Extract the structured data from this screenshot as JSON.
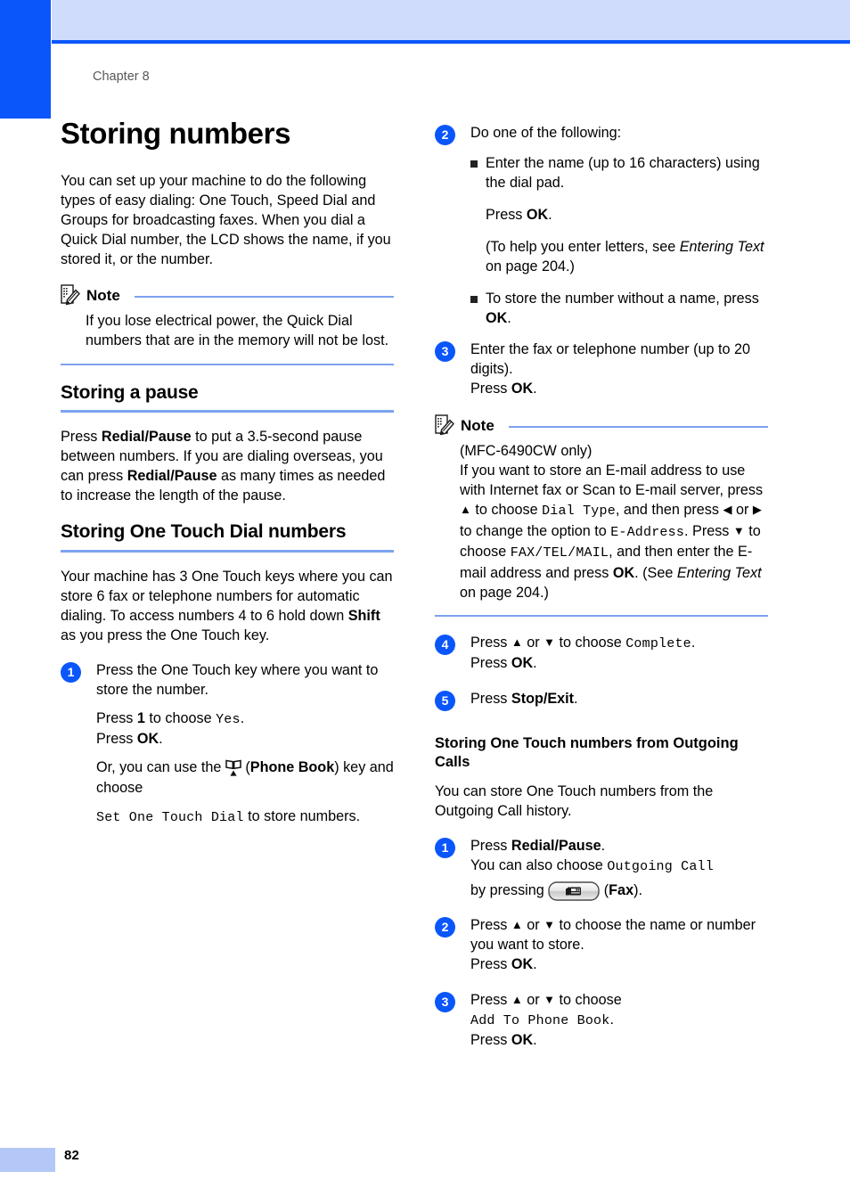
{
  "page": {
    "chapter_label": "Chapter 8",
    "page_number": "82",
    "accent_blue": "#0a56fb",
    "rule_blue": "#7da2ef",
    "band_blue": "#cfdcfb",
    "footer_blue": "#b3c8f7"
  },
  "left_column": {
    "title": "Storing numbers",
    "intro": "You can set up your machine to do the following types of easy dialing: One Touch, Speed Dial and Groups for broadcasting faxes. When you dial a Quick Dial number, the LCD shows the name, if you stored it, or the number.",
    "note": {
      "label": "Note",
      "body": "If you lose electrical power, the Quick Dial numbers that are in the memory will not be lost."
    },
    "pause_section": {
      "heading": "Storing a pause",
      "text_1": "Press ",
      "bold_1": "Redial/Pause",
      "text_2": " to put a 3.5-second pause between numbers. If you are dialing overseas, you can press ",
      "bold_2": "Redial/Pause",
      "text_3": " as many times as needed to increase the length of the pause."
    },
    "onetouch_section": {
      "heading": "Storing One Touch Dial numbers",
      "text_1": "Your machine has 3 One Touch keys where you can store 6 fax or telephone numbers for automatic dialing. To access numbers 4 to 6 hold down ",
      "bold_1": "Shift",
      "text_2": " as you press the One Touch key."
    },
    "step_1": {
      "number": "1",
      "line_1": "Press the One Touch key where you want to store the number.",
      "line_2_a": "Press ",
      "line_2_bold": "1",
      "line_2_b": " to choose ",
      "line_2_lcd": "Yes",
      "line_2_c": ".",
      "line_3_a": "Press ",
      "line_3_bold": "OK",
      "line_3_b": ".",
      "line_4_a": "Or, you can use the ",
      "line_4_icon": "phone-book-icon",
      "line_4_b": " (",
      "line_4_bold": "Phone Book",
      "line_4_c": ") key and choose",
      "line_5_lcd": "Set One Touch Dial",
      "line_5_b": " to store numbers."
    }
  },
  "right_column": {
    "step_2": {
      "number": "2",
      "lead": "Do one of the following:",
      "bullet_1": {
        "line_1": "Enter the name (up to 16 characters) using the dial pad.",
        "line_2_a": "Press ",
        "line_2_bold": "OK",
        "line_2_b": ".",
        "line_3_a": " (To help you enter letters, see ",
        "line_3_italic": "Entering Text",
        "line_3_b": " on page 204.)"
      },
      "bullet_2": {
        "text_a": "To store the number without a name, press ",
        "text_bold": "OK",
        "text_b": "."
      }
    },
    "step_3": {
      "number": "3",
      "line_1": "Enter the fax or telephone number (up to 20 digits).",
      "line_2_a": "Press ",
      "line_2_bold": "OK",
      "line_2_b": "."
    },
    "note": {
      "label": "Note",
      "line_1": "(MFC-6490CW only)",
      "p_a": "If you want to store an E-mail address to use with Internet fax or Scan to E-mail server, press ",
      "p_arrow_up": "▲",
      "p_b": " to choose ",
      "p_lcd_1": "Dial Type",
      "p_c": ", and then press ",
      "p_arrow_left": "◀",
      "p_d": " or ",
      "p_arrow_right": "▶",
      "p_e": " to change the option to ",
      "p_lcd_2": "E-Address",
      "p_f": ". Press ",
      "p_arrow_down": "▼",
      "p_g": " to choose ",
      "p_lcd_3": "FAX/TEL/MAIL",
      "p_h": ", and then enter the E-mail address and press ",
      "p_bold": "OK",
      "p_i": ". (See ",
      "p_italic": "Entering Text",
      "p_j": " on page 204.)"
    },
    "step_4": {
      "number": "4",
      "line_1_a": "Press ",
      "line_1_up": "▲",
      "line_1_b": " or ",
      "line_1_down": "▼",
      "line_1_c": " to choose ",
      "line_1_lcd": "Complete",
      "line_1_d": ".",
      "line_2_a": "Press ",
      "line_2_bold": "OK",
      "line_2_b": "."
    },
    "step_5": {
      "number": "5",
      "text_a": "Press ",
      "text_bold": "Stop/Exit",
      "text_b": "."
    },
    "outgoing_section": {
      "heading": "Storing One Touch numbers from Outgoing Calls",
      "intro": "You can store One Touch numbers from the Outgoing Call history."
    },
    "out_step_1": {
      "number": "1",
      "line_1_a": "Press ",
      "line_1_bold": "Redial/Pause",
      "line_1_b": ".",
      "line_2_a": "You can also choose ",
      "line_2_lcd": "Outgoing Call",
      "line_3_a": "by pressing ",
      "line_3_icon": "fax-key-icon",
      "line_3_b": " (",
      "line_3_bold": "Fax",
      "line_3_c": ")."
    },
    "out_step_2": {
      "number": "2",
      "line_1_a": "Press ",
      "line_1_up": "▲",
      "line_1_b": " or ",
      "line_1_down": "▼",
      "line_1_c": " to choose the name or number you want to store.",
      "line_2_a": "Press ",
      "line_2_bold": "OK",
      "line_2_b": "."
    },
    "out_step_3": {
      "number": "3",
      "line_1_a": "Press ",
      "line_1_up": "▲",
      "line_1_b": " or ",
      "line_1_down": "▼",
      "line_1_c": " to choose",
      "line_2_lcd": "Add To Phone Book",
      "line_2_b": ".",
      "line_3_a": "Press ",
      "line_3_bold": "OK",
      "line_3_b": "."
    }
  }
}
